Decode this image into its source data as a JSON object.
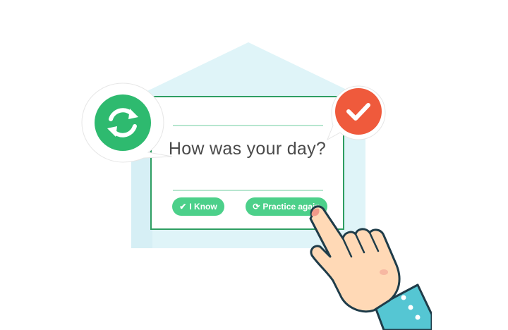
{
  "card": {
    "question": "How was your day?"
  },
  "buttons": {
    "know_icon": "✔",
    "know_label": "I Know",
    "practice_icon": "⟳",
    "practice_label": "Practice again"
  },
  "icons": {
    "left_bubble": "refresh-icon",
    "right_bubble": "checkmark-icon",
    "pointer": "pointing-hand-icon"
  },
  "colors": {
    "green": "#2eba6f",
    "green_light": "#4cd08a",
    "orange": "#ef5a3c",
    "card_border": "#2e9e62",
    "house": "#dff4f8"
  }
}
